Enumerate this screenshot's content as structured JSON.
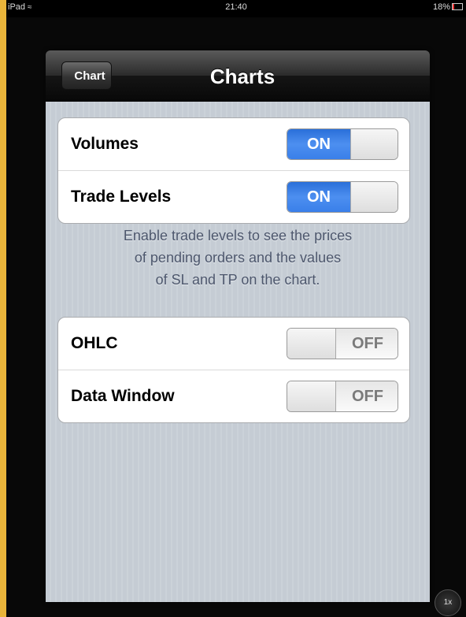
{
  "status_bar": {
    "device": "iPad",
    "time": "21:40",
    "battery": "18%"
  },
  "nav": {
    "back_label": "Chart",
    "title": "Charts"
  },
  "group1": [
    {
      "label": "Volumes",
      "state": "ON"
    },
    {
      "label": "Trade Levels",
      "state": "ON"
    }
  ],
  "footnote": {
    "line1": "Enable trade levels to see the prices",
    "line2": "of pending orders and the values",
    "line3": "of SL and TP on the chart."
  },
  "group2": [
    {
      "label": "OHLC",
      "state": "OFF"
    },
    {
      "label": "Data Window",
      "state": "OFF"
    }
  ],
  "zoom_label": "1x",
  "colors": {
    "switch_on": "#3a7fe9",
    "nav_bar": "#1a1a1a",
    "background": "#c5ccd4",
    "frame": "#e9b43a"
  }
}
